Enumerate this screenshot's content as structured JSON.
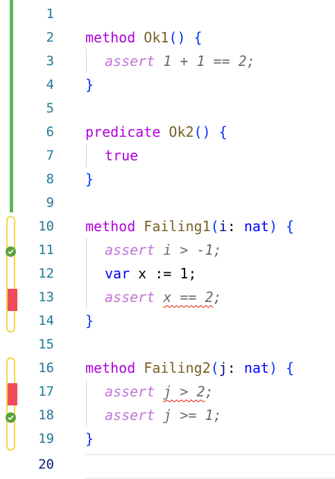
{
  "colors": {
    "verified_gutter": "#5fb85a",
    "range_outline": "#f2d64a",
    "failure_marker": "#f24a5a",
    "success_check": "#5aa23a",
    "line_number": "#237893",
    "error_squiggle": "#e51400"
  },
  "editor": {
    "line_numbers": [
      "1",
      "2",
      "3",
      "4",
      "5",
      "6",
      "7",
      "8",
      "9",
      "10",
      "11",
      "12",
      "13",
      "14",
      "15",
      "16",
      "17",
      "18",
      "19",
      "20"
    ],
    "lines": {
      "l2": {
        "kw": "method",
        "name": "Ok1",
        "open": "()",
        "brace": " {"
      },
      "l3": {
        "kw": "assert",
        "expr": " 1 + 1 == 2;"
      },
      "l4": {
        "close": "}"
      },
      "l6": {
        "kw": "predicate",
        "name": "Ok2",
        "open": "()",
        "brace": " {"
      },
      "l7": {
        "val": "true"
      },
      "l8": {
        "close": "}"
      },
      "l10": {
        "kw": "method",
        "name": "Failing1",
        "paren_open": "(",
        "param": "i",
        "colon": ": ",
        "type": "nat",
        "paren_close": ")",
        "brace": " {"
      },
      "l11": {
        "kw": "assert",
        "expr": " i > -1;"
      },
      "l12": {
        "kw": "var",
        "rest": " x := 1;"
      },
      "l13": {
        "kw": "assert",
        "space": " ",
        "err": "x == 2",
        "semi": ";"
      },
      "l14": {
        "close": "}"
      },
      "l16": {
        "kw": "method",
        "name": "Failing2",
        "paren_open": "(",
        "param": "j",
        "colon": ": ",
        "type": "nat",
        "paren_close": ")",
        "brace": " {"
      },
      "l17": {
        "kw": "assert",
        "space": " ",
        "err": "j > 2",
        "semi": ";"
      },
      "l18": {
        "kw": "assert",
        "expr": " j >= 1;"
      },
      "l19": {
        "close": "}"
      }
    }
  },
  "gutter": {
    "verified_status": "verified",
    "line_11_status": "success-icon",
    "line_13_status": "failure",
    "line_17_status": "failure",
    "line_18_status": "success-icon"
  }
}
